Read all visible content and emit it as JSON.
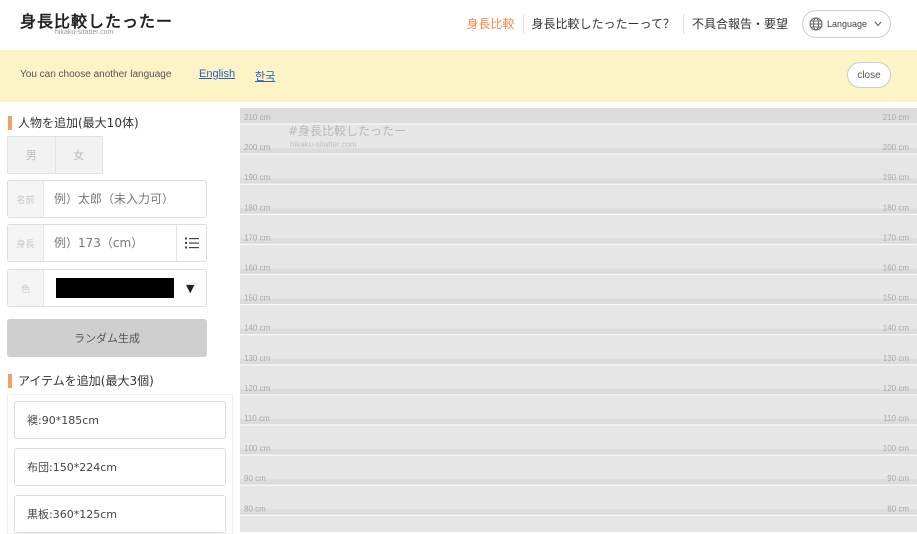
{
  "header": {
    "title": "身長比較したったー",
    "subtitle": "hikaku-sitatter.com",
    "nav": [
      "身長比較",
      "身長比較したったーって？",
      "不具合報告・要望"
    ],
    "language_label": "Language"
  },
  "language_bar": {
    "text": "You can choose another language",
    "links": [
      "English",
      "한국"
    ],
    "close_label": "close"
  },
  "add_person": {
    "heading": "人物を追加(最大10体)",
    "gender_buttons": [
      "男",
      "女"
    ],
    "name_label": "名前",
    "name_placeholder": "例）太郎（未入力可）",
    "height_label": "身長",
    "height_placeholder": "例）173（cm）",
    "color_label": "色",
    "color_value": "#000000",
    "random_label": "ランダム生成"
  },
  "add_item": {
    "heading": "アイテムを追加(最大3個)",
    "items": [
      "襖:90*185cm",
      "布団:150*224cm",
      "黒板:360*125cm"
    ]
  },
  "chart": {
    "watermark_title": "#身長比較したったー",
    "watermark_sub": "hikaku-sitatter.com",
    "ticks": [
      "210 cm",
      "200 cm",
      "190 cm",
      "180 cm",
      "170 cm",
      "160 cm",
      "150 cm",
      "140 cm",
      "130 cm",
      "120 cm",
      "110 cm",
      "100 cm",
      "90 cm",
      "80 cm"
    ]
  }
}
